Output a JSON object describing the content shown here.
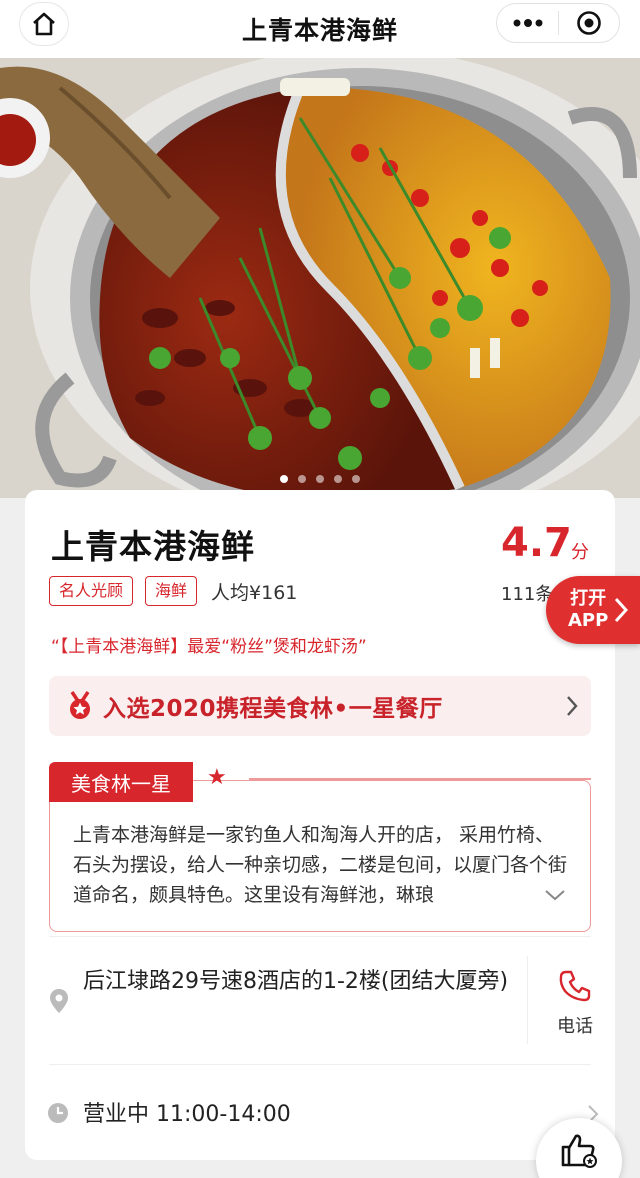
{
  "nav": {
    "title": "上青本港海鲜",
    "home_icon": "home-icon",
    "more_icon": "more-dots-icon",
    "close_icon": "target-close-icon"
  },
  "hero": {
    "image": "hotpot-fish-photo",
    "dots_total": 5,
    "dots_active": 1
  },
  "restaurant": {
    "name": "上青本港海鲜",
    "score": "4.7",
    "score_unit": "分",
    "tags": [
      "名人光顾",
      "海鲜"
    ],
    "avg_price": "人均¥161",
    "reviews": "111条点",
    "quote": "“【上青本港海鲜】最爱“粉丝”煲和龙虾汤”"
  },
  "banner": {
    "text": "入选2020携程美食林•一星餐厅",
    "icon": "medal-icon"
  },
  "description": {
    "badge": "美食林一星",
    "star": "★",
    "text": "上青本港海鲜是一家钓鱼人和淘海人开的店， 采用竹椅、石头为摆设，给人一种亲切感，二楼是包间，以厦门各个街道命名，颇具特色。这里设有海鲜池，琳琅"
  },
  "address": {
    "text": "后江埭路29号速8酒店的1-2楼(团结大厦旁)",
    "phone_label": "电话"
  },
  "hours": {
    "text": "营业中 11:00-14:00"
  },
  "floating": {
    "open_app": [
      "打开",
      "APP"
    ],
    "like_icon": "thumbs-up-icon"
  },
  "colors": {
    "accent": "#d8262d",
    "banner_bg": "#fbeeee",
    "page_bg": "#efefef"
  }
}
